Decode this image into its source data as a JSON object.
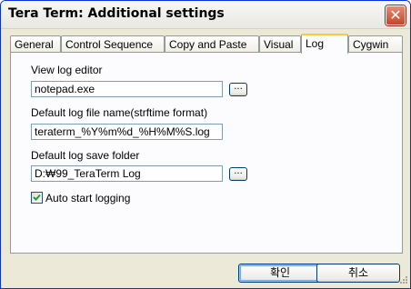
{
  "window": {
    "title": "Tera Term: Additional settings",
    "close_label": "✕"
  },
  "tabs": [
    {
      "label": "General"
    },
    {
      "label": "Control Sequence"
    },
    {
      "label": "Copy and Paste"
    },
    {
      "label": "Visual"
    },
    {
      "label": "Log",
      "active": true
    },
    {
      "label": "Cygwin"
    }
  ],
  "log": {
    "view_editor_label": "View log editor",
    "view_editor_value": "notepad.exe",
    "filename_label": "Default log file name(strftime format)",
    "filename_value": "teraterm_%Y%m%d_%H%M%S.log",
    "folder_label": "Default log save folder",
    "folder_value": "D:₩99_TeraTerm Log",
    "browse_label": "...",
    "auto_start_label": "Auto start logging",
    "auto_start_checked": true
  },
  "buttons": {
    "ok": "확인",
    "cancel": "취소"
  }
}
